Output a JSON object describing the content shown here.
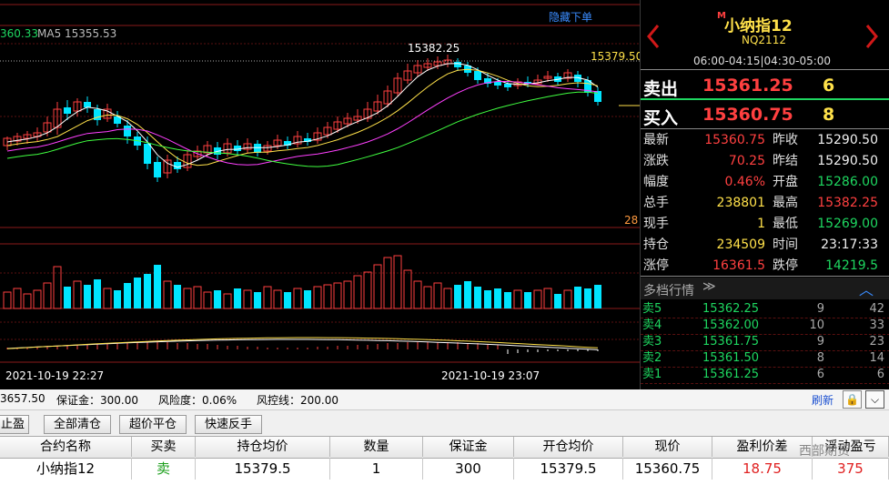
{
  "chart": {
    "ma_legend_a": "360.33",
    "ma_legend_b": "MA5 15355.53",
    "hide_menu": "隐藏下单",
    "high_label": "15382.25",
    "price_line_label": "15379.50",
    "right_edge_label": "28",
    "time_left": "2021-10-19 22:27",
    "time_right": "2021-10-19 23:07",
    "colors": {
      "up": "#ff4040",
      "down": "#00e5ff",
      "ma1": "#ffffff",
      "ma2": "#ffe14a",
      "ma3": "#ff40ff",
      "ma4": "#40ff40",
      "grid": "#8a1a1a"
    }
  },
  "quote": {
    "title_mark": "M",
    "title": "小纳指12",
    "code": "NQ2112",
    "session": "06:00-04:15|04:30-05:00",
    "ask": {
      "label": "卖出",
      "price": "15361.25",
      "qty": "6"
    },
    "bid": {
      "label": "买入",
      "price": "15360.75",
      "qty": "8"
    },
    "stats": [
      {
        "l1": "最新",
        "v1": "15360.75",
        "l2": "昨收",
        "v2": "15290.50"
      },
      {
        "l1": "涨跌",
        "v1": "70.25",
        "l2": "昨结",
        "v2": "15290.50"
      },
      {
        "l1": "幅度",
        "v1": "0.46%",
        "l2": "开盘",
        "v2": "15286.00"
      },
      {
        "l1": "总手",
        "v1": "238801",
        "l2": "最高",
        "v2": "15382.25"
      },
      {
        "l1": "现手",
        "v1": "1",
        "l2": "最低",
        "v2": "15269.00"
      },
      {
        "l1": "持仓",
        "v1": "234509",
        "l2": "时间",
        "v2": "23:17:33"
      },
      {
        "l1": "涨停",
        "v1": "16361.5",
        "l2": "跌停",
        "v2": "14219.5"
      }
    ],
    "depth_title": "多档行情",
    "depth": [
      {
        "label": "卖5",
        "price": "15362.25",
        "qty": "9",
        "vol": "42"
      },
      {
        "label": "卖4",
        "price": "15362.00",
        "qty": "10",
        "vol": "33"
      },
      {
        "label": "卖3",
        "price": "15361.75",
        "qty": "9",
        "vol": "23"
      },
      {
        "label": "卖2",
        "price": "15361.50",
        "qty": "8",
        "vol": "14"
      },
      {
        "label": "卖1",
        "price": "15361.25",
        "qty": "6",
        "vol": "6"
      }
    ]
  },
  "account": {
    "balance": "3657.50",
    "margin": "保证金：300.00",
    "risk": "风险度：0.06%",
    "control": "风控线：200.00",
    "refresh": "刷新"
  },
  "buttons": {
    "stop": "止盈",
    "close_all": "全部清仓",
    "flat": "超价平仓",
    "reverse": "快速反手"
  },
  "positions": {
    "headers": [
      "合约名称",
      "买卖",
      "持仓均价",
      "数量",
      "保证金",
      "开仓均价",
      "现价",
      "盈利价差",
      "浮动盈亏"
    ],
    "row": {
      "name": "小纳指12",
      "side": "卖",
      "avg": "15379.5",
      "qty": "1",
      "margin": "300",
      "open": "15379.5",
      "price": "15360.75",
      "diff": "18.75",
      "pnl": "375"
    }
  },
  "watermark": "西部期货"
}
